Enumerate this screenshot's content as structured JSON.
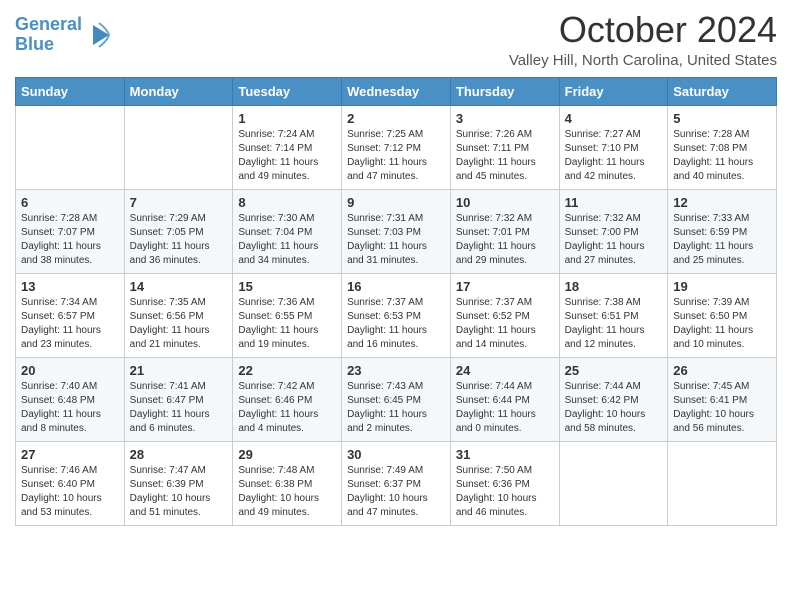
{
  "logo": {
    "line1": "General",
    "line2": "Blue",
    "icon": "▶"
  },
  "title": "October 2024",
  "location": "Valley Hill, North Carolina, United States",
  "weekdays": [
    "Sunday",
    "Monday",
    "Tuesday",
    "Wednesday",
    "Thursday",
    "Friday",
    "Saturday"
  ],
  "weeks": [
    [
      {
        "day": "",
        "info": ""
      },
      {
        "day": "",
        "info": ""
      },
      {
        "day": "1",
        "info": "Sunrise: 7:24 AM\nSunset: 7:14 PM\nDaylight: 11 hours and 49 minutes."
      },
      {
        "day": "2",
        "info": "Sunrise: 7:25 AM\nSunset: 7:12 PM\nDaylight: 11 hours and 47 minutes."
      },
      {
        "day": "3",
        "info": "Sunrise: 7:26 AM\nSunset: 7:11 PM\nDaylight: 11 hours and 45 minutes."
      },
      {
        "day": "4",
        "info": "Sunrise: 7:27 AM\nSunset: 7:10 PM\nDaylight: 11 hours and 42 minutes."
      },
      {
        "day": "5",
        "info": "Sunrise: 7:28 AM\nSunset: 7:08 PM\nDaylight: 11 hours and 40 minutes."
      }
    ],
    [
      {
        "day": "6",
        "info": "Sunrise: 7:28 AM\nSunset: 7:07 PM\nDaylight: 11 hours and 38 minutes."
      },
      {
        "day": "7",
        "info": "Sunrise: 7:29 AM\nSunset: 7:05 PM\nDaylight: 11 hours and 36 minutes."
      },
      {
        "day": "8",
        "info": "Sunrise: 7:30 AM\nSunset: 7:04 PM\nDaylight: 11 hours and 34 minutes."
      },
      {
        "day": "9",
        "info": "Sunrise: 7:31 AM\nSunset: 7:03 PM\nDaylight: 11 hours and 31 minutes."
      },
      {
        "day": "10",
        "info": "Sunrise: 7:32 AM\nSunset: 7:01 PM\nDaylight: 11 hours and 29 minutes."
      },
      {
        "day": "11",
        "info": "Sunrise: 7:32 AM\nSunset: 7:00 PM\nDaylight: 11 hours and 27 minutes."
      },
      {
        "day": "12",
        "info": "Sunrise: 7:33 AM\nSunset: 6:59 PM\nDaylight: 11 hours and 25 minutes."
      }
    ],
    [
      {
        "day": "13",
        "info": "Sunrise: 7:34 AM\nSunset: 6:57 PM\nDaylight: 11 hours and 23 minutes."
      },
      {
        "day": "14",
        "info": "Sunrise: 7:35 AM\nSunset: 6:56 PM\nDaylight: 11 hours and 21 minutes."
      },
      {
        "day": "15",
        "info": "Sunrise: 7:36 AM\nSunset: 6:55 PM\nDaylight: 11 hours and 19 minutes."
      },
      {
        "day": "16",
        "info": "Sunrise: 7:37 AM\nSunset: 6:53 PM\nDaylight: 11 hours and 16 minutes."
      },
      {
        "day": "17",
        "info": "Sunrise: 7:37 AM\nSunset: 6:52 PM\nDaylight: 11 hours and 14 minutes."
      },
      {
        "day": "18",
        "info": "Sunrise: 7:38 AM\nSunset: 6:51 PM\nDaylight: 11 hours and 12 minutes."
      },
      {
        "day": "19",
        "info": "Sunrise: 7:39 AM\nSunset: 6:50 PM\nDaylight: 11 hours and 10 minutes."
      }
    ],
    [
      {
        "day": "20",
        "info": "Sunrise: 7:40 AM\nSunset: 6:48 PM\nDaylight: 11 hours and 8 minutes."
      },
      {
        "day": "21",
        "info": "Sunrise: 7:41 AM\nSunset: 6:47 PM\nDaylight: 11 hours and 6 minutes."
      },
      {
        "day": "22",
        "info": "Sunrise: 7:42 AM\nSunset: 6:46 PM\nDaylight: 11 hours and 4 minutes."
      },
      {
        "day": "23",
        "info": "Sunrise: 7:43 AM\nSunset: 6:45 PM\nDaylight: 11 hours and 2 minutes."
      },
      {
        "day": "24",
        "info": "Sunrise: 7:44 AM\nSunset: 6:44 PM\nDaylight: 11 hours and 0 minutes."
      },
      {
        "day": "25",
        "info": "Sunrise: 7:44 AM\nSunset: 6:42 PM\nDaylight: 10 hours and 58 minutes."
      },
      {
        "day": "26",
        "info": "Sunrise: 7:45 AM\nSunset: 6:41 PM\nDaylight: 10 hours and 56 minutes."
      }
    ],
    [
      {
        "day": "27",
        "info": "Sunrise: 7:46 AM\nSunset: 6:40 PM\nDaylight: 10 hours and 53 minutes."
      },
      {
        "day": "28",
        "info": "Sunrise: 7:47 AM\nSunset: 6:39 PM\nDaylight: 10 hours and 51 minutes."
      },
      {
        "day": "29",
        "info": "Sunrise: 7:48 AM\nSunset: 6:38 PM\nDaylight: 10 hours and 49 minutes."
      },
      {
        "day": "30",
        "info": "Sunrise: 7:49 AM\nSunset: 6:37 PM\nDaylight: 10 hours and 47 minutes."
      },
      {
        "day": "31",
        "info": "Sunrise: 7:50 AM\nSunset: 6:36 PM\nDaylight: 10 hours and 46 minutes."
      },
      {
        "day": "",
        "info": ""
      },
      {
        "day": "",
        "info": ""
      }
    ]
  ]
}
